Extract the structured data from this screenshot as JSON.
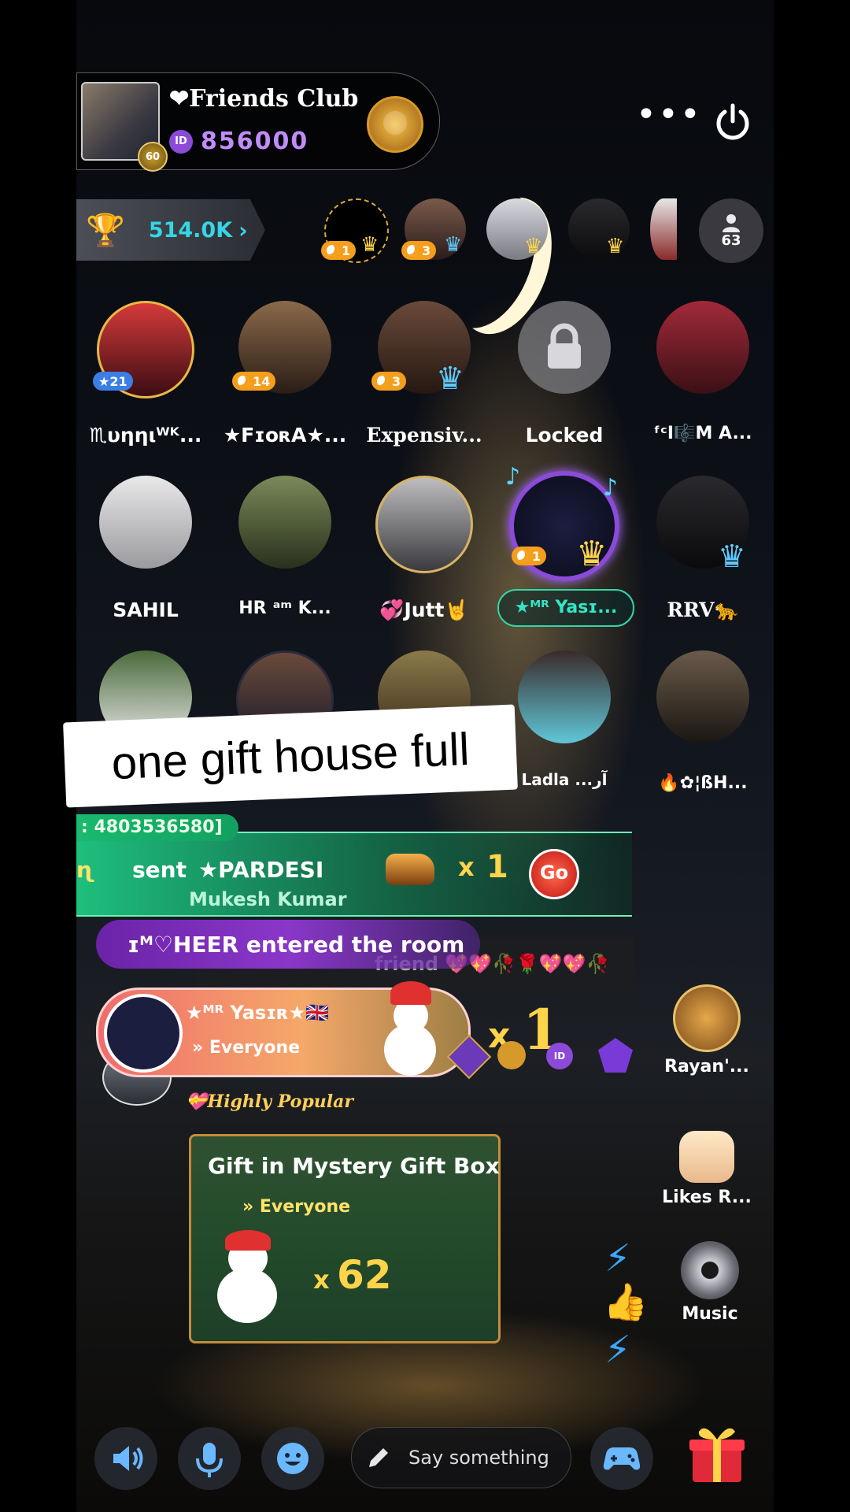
{
  "header": {
    "room_title": "❤Friends Club",
    "id_badge": "ID",
    "room_id": "856000",
    "host_level": "60",
    "more_label": "•••"
  },
  "trophy": {
    "value": "514.0K",
    "chevron": "›"
  },
  "top_users": [
    {
      "count": "1",
      "crown": "gold"
    },
    {
      "count": "3",
      "crown": "blue"
    },
    {
      "count": "",
      "crown": ""
    },
    {
      "count": "",
      "crown": ""
    }
  ],
  "viewer_count": "63",
  "seats": [
    {
      "name": "♏υηηιᵂᴷ...",
      "badge": "★21",
      "badge_color": "blue"
    },
    {
      "name": "★FɪᴏʀA★...",
      "badge": "14",
      "badge_color": "orange"
    },
    {
      "name": "Expensiv...",
      "badge": "3",
      "badge_color": "orange"
    },
    {
      "name": "Locked",
      "badge": "",
      "badge_color": ""
    },
    {
      "name": "ᶠᶜI🎼M A...",
      "badge": "",
      "badge_color": ""
    },
    {
      "name": "SAHIL",
      "badge": "",
      "badge_color": ""
    },
    {
      "name": "HR ᵃᵐ K...",
      "badge": "",
      "badge_color": ""
    },
    {
      "name": "💞Jutt🤘",
      "badge": "",
      "badge_color": ""
    },
    {
      "name": "★ᴹᴿ Yasɪ...",
      "badge": "1",
      "badge_color": "orange"
    },
    {
      "name": "RRV🐆",
      "badge": "",
      "badge_color": ""
    },
    {
      "name": "",
      "badge": "",
      "badge_color": ""
    },
    {
      "name": "",
      "badge": "",
      "badge_color": ""
    },
    {
      "name": "",
      "badge": "",
      "badge_color": ""
    },
    {
      "name": "Ladla ...آر",
      "badge": "",
      "badge_color": ""
    },
    {
      "name": "🔥✿¦ßH...",
      "badge": "",
      "badge_color": ""
    }
  ],
  "caption": "one gift house full",
  "gift_banner": {
    "id_strip": ": 4803536580]",
    "sender": "ɳ",
    "sent_label": "sent",
    "target": "★PARDESI",
    "x_label": "x",
    "count": "1",
    "go_label": "Go",
    "receiver": "Mukesh Kumar"
  },
  "entry": {
    "text": "ɪᴹ♡HEER  entered the room"
  },
  "chat_strip": {
    "text": "friend 💖💖🥀🌹💖💖🥀"
  },
  "broadcast": {
    "sender": "★ᴹᴿ Yasɪʀ★🇬🇧",
    "target": "Everyone",
    "x_label": "x",
    "count": "1"
  },
  "popular_tag": "Highly Popular",
  "mystery_box": {
    "title": "Gift in Mystery Gift Box",
    "target": "Everyone",
    "x_label": "x",
    "count": "62"
  },
  "side": {
    "rayan_label": "Rayan'...",
    "likes_label": "Likes R...",
    "music_label": "Music"
  },
  "bottom": {
    "say_placeholder": "Say something"
  },
  "colors": {
    "accent_cyan": "#35d6e6",
    "gold": "#ffd34a",
    "green_banner": "#1ec882",
    "purple_banner": "#8a37c9"
  }
}
